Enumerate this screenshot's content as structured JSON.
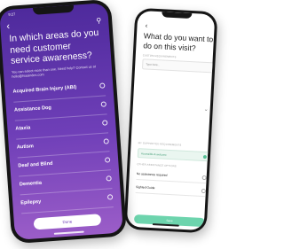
{
  "colors": {
    "accent_purple": "#6f3fb8",
    "accent_green": "#6dd4ad"
  },
  "front_screen": {
    "status_time": "9:27",
    "back_icon": "chevron-left-icon",
    "search_icon": "search-icon",
    "title": "In which areas do you need customer service awareness?",
    "help_text": "You can select more than one. Need help? Contact us at hello@hiaaindex.com",
    "options": [
      {
        "label": "Acquired Brain Injury (ABI)"
      },
      {
        "label": "Assistance Dog"
      },
      {
        "label": "Ataxia"
      },
      {
        "label": "Autism"
      },
      {
        "label": "Deaf and Blind"
      },
      {
        "label": "Dementia"
      },
      {
        "label": "Epilepsy"
      }
    ],
    "done_label": "Done"
  },
  "back_screen": {
    "back_icon": "chevron-left-icon",
    "title": "What do you want to do on this visit?",
    "custom_label": "CUSTOM REQUIREMENTS",
    "custom_placeholder": "Type here...",
    "supported_label": "MY SUPPORTED REQUIREMENTS",
    "supported_chip": "Accessible & welcome",
    "other_label": "OTHER ASSISTANCE OPTIONS",
    "rows": [
      {
        "label": "No assistance required"
      },
      {
        "label": "Sighted Guide"
      }
    ],
    "save_label": "Save"
  }
}
